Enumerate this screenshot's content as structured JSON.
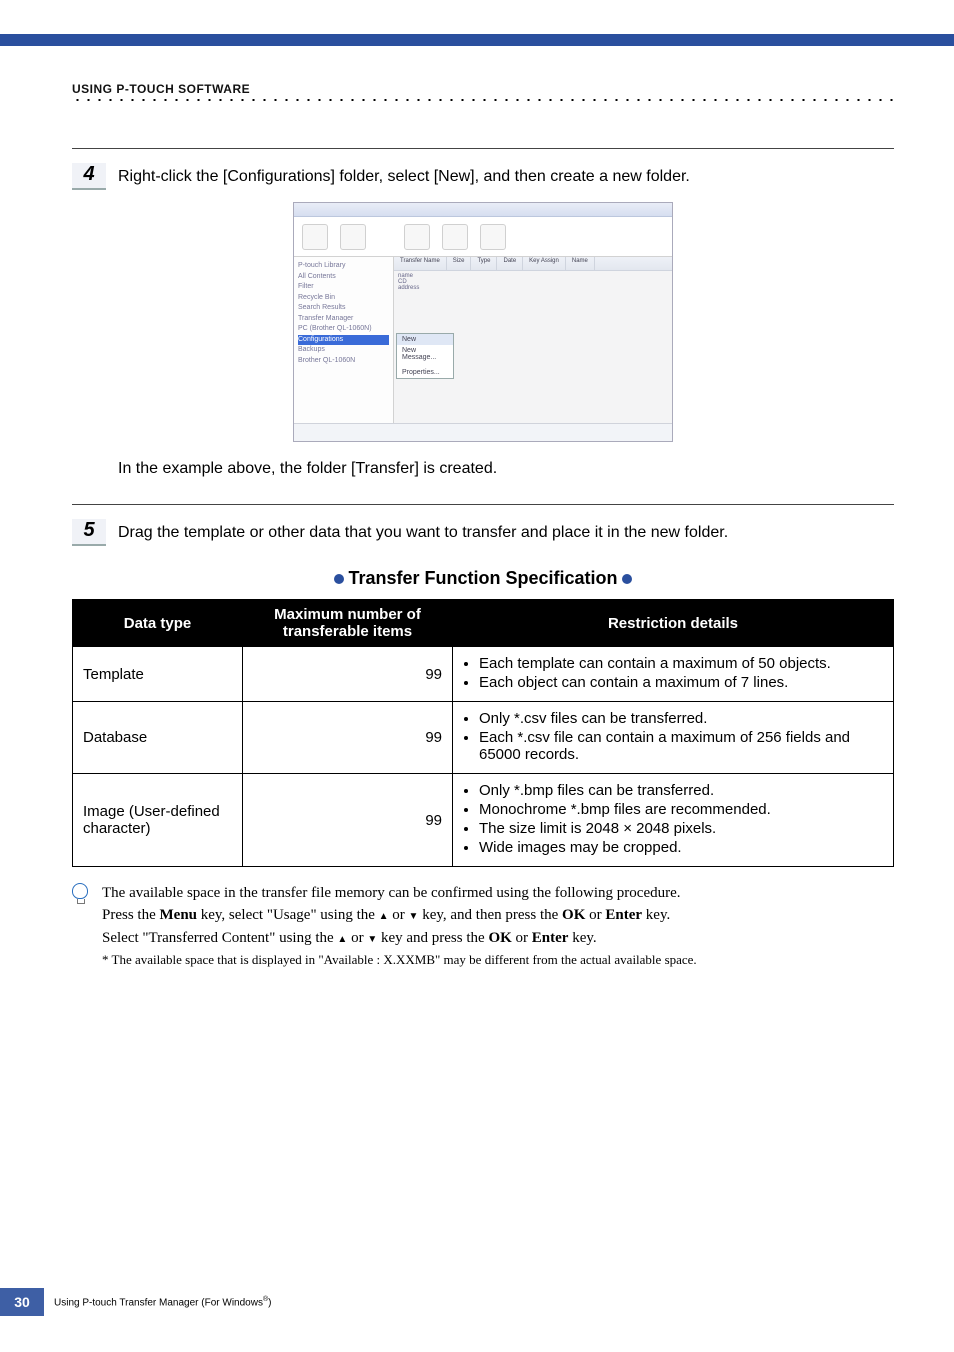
{
  "chapter": "USING P-TOUCH SOFTWARE",
  "steps": {
    "s4": {
      "num": "4",
      "text": "Right-click the [Configurations] folder, select [New], and then create a new folder."
    },
    "example_text": "In the example above, the folder [Transfer] is created.",
    "s5": {
      "num": "5",
      "text": "Drag the template or other data that you want to transfer and place it in the new folder."
    }
  },
  "section_title": "Transfer Function Specification",
  "table": {
    "head": {
      "c1": "Data type",
      "c2": "Maximum number of transferable items",
      "c3": "Restriction details"
    },
    "rows": [
      {
        "c1": "Template",
        "c2": "99",
        "c3": [
          "Each template can contain a maximum of 50 objects.",
          "Each object can contain a maximum of 7 lines."
        ]
      },
      {
        "c1": "Database",
        "c2": "99",
        "c3": [
          "Only *.csv files can be transferred.",
          "Each *.csv file can contain a maximum of 256 fields and 65000 records."
        ]
      },
      {
        "c1": "Image (User-defined character)",
        "c2": "99",
        "c3": [
          "Only *.bmp files can be transferred.",
          "Monochrome *.bmp files are recommended.",
          "The size limit is 2048 × 2048 pixels.",
          "Wide images may be cropped."
        ]
      }
    ]
  },
  "note": {
    "l1a": "The available space in the transfer file memory can be confirmed using the following procedure.",
    "l2a": "Press the ",
    "l2menu": "Menu",
    "l2b": " key, select \"Usage\" using the ",
    "l2c": " or ",
    "l2d": " key, and then press the ",
    "l2ok": "OK",
    "l2e": " or ",
    "l2enter": "Enter",
    "l2f": " key.",
    "l3a": "Select \"Transferred Content\" using the ",
    "l3b": " or ",
    "l3c": " key and press the ",
    "l3ok": "OK",
    "l3d": " or ",
    "l3enter": "Enter",
    "l3e": " key.",
    "small": "* The available space that is displayed in \"Available : X.XXMB\" may be different from the actual available space."
  },
  "screenshot": {
    "tree": [
      "P-touch Library",
      "  All Contents",
      "  Filter",
      "  Recycle Bin",
      "  Search Results",
      "Transfer Manager",
      "  PC (Brother QL-1060N)",
      "    Configurations",
      "    Backups",
      "  Brother QL-1060N"
    ],
    "cols": [
      "Transfer Name",
      "Size",
      "Type",
      "Date",
      "Key Assign",
      "Name"
    ],
    "rows": [
      "name",
      "CD",
      "address"
    ],
    "ctx": [
      "New",
      "New Message...",
      "",
      "Properties..."
    ]
  },
  "footer": {
    "page_num": "30",
    "label_a": "Using P-touch Transfer Manager (For Windows",
    "label_reg": "®",
    "label_b": ")"
  }
}
